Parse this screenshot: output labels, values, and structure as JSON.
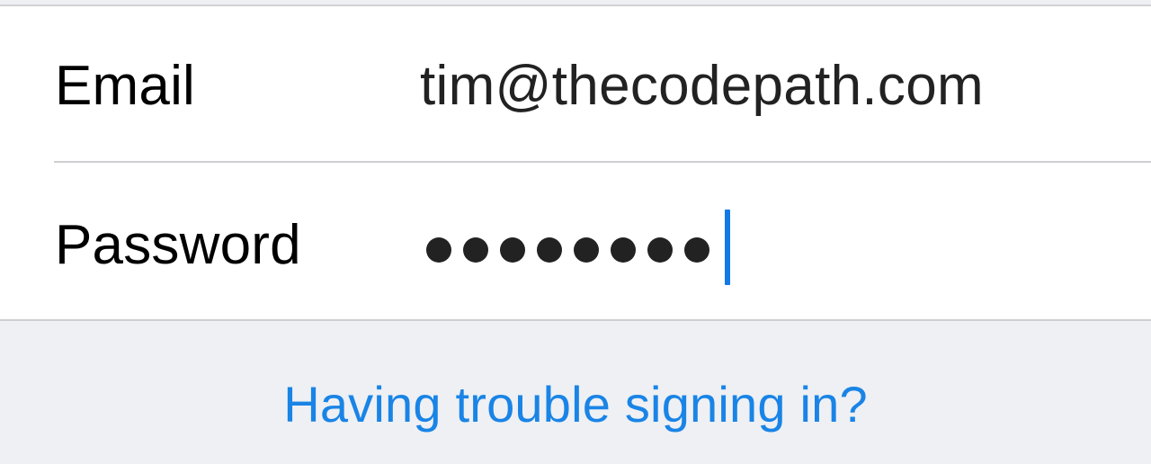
{
  "form": {
    "email": {
      "label": "Email",
      "value": "tim@thecodepath.com"
    },
    "password": {
      "label": "Password",
      "masked_length": 8,
      "caret_visible": true
    }
  },
  "footer": {
    "help_link_label": "Having trouble signing in?"
  },
  "colors": {
    "link": "#1a84e6",
    "caret": "#1479e8",
    "background": "#eef0f3",
    "card": "#ffffff"
  }
}
